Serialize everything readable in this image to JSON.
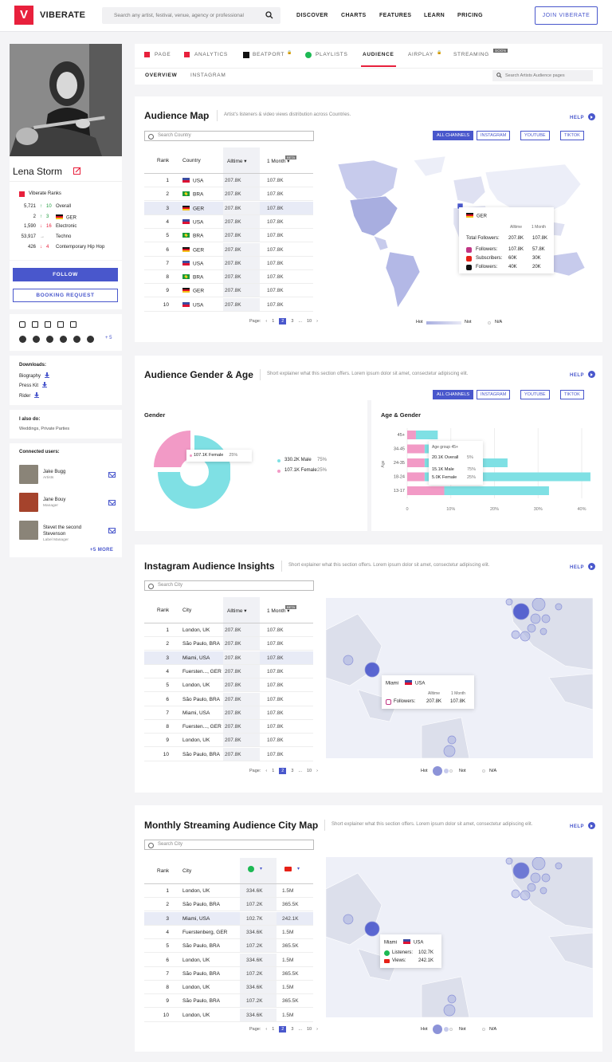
{
  "header": {
    "logo_mark": "V",
    "logo_text": "VIBERATE",
    "search_placeholder": "Search any artist, festival, venue, agency or professional",
    "nav": [
      "DISCOVER",
      "CHARTS",
      "FEATURES",
      "LEARN",
      "PRICING"
    ],
    "join": "JOIN VIBERATE"
  },
  "artist": {
    "name": "Lena Storm",
    "ranks_title": "Viberate Ranks",
    "ranks": [
      {
        "value": "5,721",
        "change": "10",
        "dir": "up",
        "label": "Overall"
      },
      {
        "value": "2",
        "change": "3",
        "dir": "up",
        "label": "GER",
        "flag": "ger"
      },
      {
        "value": "1,590",
        "change": "16",
        "dir": "down",
        "label": "Electronic"
      },
      {
        "value": "53,917",
        "change": "",
        "dir": "flat",
        "label": "Techno"
      },
      {
        "value": "426",
        "change": "4",
        "dir": "down",
        "label": "Contemporary Hip Hop"
      }
    ],
    "follow": "FOLLOW",
    "booking": "BOOKING REQUEST",
    "more_socials": "+ 5",
    "downloads_title": "Downloads:",
    "downloads": [
      "Biography",
      "Press Kit",
      "Rider"
    ],
    "also_title": "I also do:",
    "also": "Weddings, Private Parties",
    "connected_title": "Connected users:",
    "users": [
      {
        "name": "Jake Bugg",
        "role": "Artists"
      },
      {
        "name": "Jane Bouy",
        "role": "Manager"
      },
      {
        "name": "Stevet the second Stevenson",
        "role": "Label Manager"
      }
    ],
    "more_users": "+5 MORE"
  },
  "tabs": {
    "items": [
      "PAGE",
      "ANALYTICS",
      "BEATPORT",
      "PLAYLISTS",
      "AUDIENCE",
      "AIRPLAY",
      "STREAMING"
    ],
    "soon": "SOON",
    "sub": [
      "OVERVIEW",
      "INSTAGRAM"
    ],
    "search": "Search Artists Audience pages"
  },
  "audience_map": {
    "title": "Audience Map",
    "subtitle": "Artist's listeners & video views distribution across Countries.",
    "help": "HELP",
    "search": "Search Country",
    "channels": [
      "ALL CHANNELS",
      "INSTAGRAM",
      "YOUTUBE",
      "TIKTOK"
    ],
    "cols": [
      "Rank",
      "Country",
      "Alltime",
      "1 Month",
      "BETA"
    ],
    "rows": [
      [
        "1",
        "USA",
        "usa",
        "207.8K",
        "107.8K"
      ],
      [
        "2",
        "BRA",
        "bra",
        "207.8K",
        "107.8K"
      ],
      [
        "3",
        "GER",
        "ger",
        "207.8K",
        "107.8K"
      ],
      [
        "4",
        "USA",
        "usa",
        "207.8K",
        "107.8K"
      ],
      [
        "5",
        "BRA",
        "bra",
        "207.8K",
        "107.8K"
      ],
      [
        "6",
        "GER",
        "ger",
        "207.8K",
        "107.8K"
      ],
      [
        "7",
        "USA",
        "usa",
        "207.8K",
        "107.8K"
      ],
      [
        "8",
        "BRA",
        "bra",
        "207.8K",
        "107.8K"
      ],
      [
        "9",
        "GER",
        "ger",
        "207.8K",
        "107.8K"
      ],
      [
        "10",
        "USA",
        "usa",
        "207.8K",
        "107.8K"
      ]
    ],
    "tooltip": {
      "country": "GER",
      "col1": "Alltime",
      "col2": "1 Month",
      "total_label": "Total Followers:",
      "total_a": "207.8K",
      "total_b": "107.8K",
      "lines": [
        [
          "Followers:",
          "107.8K",
          "57.8K"
        ],
        [
          "Subscribers:",
          "60K",
          "30K"
        ],
        [
          "Followers:",
          "40K",
          "20K"
        ]
      ]
    },
    "legend": {
      "hot": "Hot",
      "not": "Not",
      "na": "N/A"
    }
  },
  "pagination": {
    "label": "Page:",
    "pages": [
      "1",
      "2",
      "3",
      "...",
      "10"
    ]
  },
  "gender_age": {
    "title": "Audience Gender & Age",
    "subtitle": "Short explainer what this section offers. Lorem ipsum dolor sit amet, consectetur adipiscing elit.",
    "help": "HELP",
    "gender_title": "Gender",
    "age_title": "Age & Gender",
    "female_tip": "107.1K Female",
    "female_pct": "25%",
    "legend": [
      {
        "label": "330.2K Male",
        "pct": "75%",
        "color": "#7fe0e4"
      },
      {
        "label": "107.1K Female",
        "pct": "25%",
        "color": "#f29ac6"
      }
    ],
    "age_groups": [
      "45+",
      "34-45",
      "24-35",
      "18-24",
      "13-17"
    ],
    "age_axis": "Age",
    "ticks": [
      "0",
      "10%",
      "20%",
      "30%",
      "40%"
    ],
    "age_tip": {
      "title": "Age group 45+",
      "overall": "20.1K Overall",
      "overall_pct": "5%",
      "male": "15.1K Male",
      "male_pct": "75%",
      "female": "5.0K Female",
      "female_pct": "25%"
    }
  },
  "chart_data": {
    "type": "bar",
    "orientation": "horizontal",
    "stacked": true,
    "categories": [
      "45+",
      "34-45",
      "24-35",
      "18-24",
      "13-17"
    ],
    "series": [],
    "xlim": [
      0,
      40
    ]
  },
  "chart_data_female_pct": [
    2,
    4,
    4,
    4,
    8.5
  ],
  "chart_data_male_pct": [
    5,
    5,
    19,
    38,
    24
  ],
  "instagram": {
    "title": "Instagram Audience Insights",
    "subtitle": "Short explainer what this section offers. Lorem ipsum dolor sit amet, consectetur adipiscing elit.",
    "help": "HELP",
    "search": "Search City",
    "cols": [
      "Rank",
      "City",
      "Alltime",
      "1 Month",
      "BETA"
    ],
    "rows": [
      [
        "1",
        "London, UK",
        "207.8K",
        "107.8K"
      ],
      [
        "2",
        "São Paulo, BRA",
        "207.8K",
        "107.8K"
      ],
      [
        "3",
        "Miami, USA",
        "207.8K",
        "107.8K"
      ],
      [
        "4",
        "Fuersten..., GER",
        "207.8K",
        "107.8K"
      ],
      [
        "5",
        "London, UK",
        "207.8K",
        "107.8K"
      ],
      [
        "6",
        "São Paulo, BRA",
        "207.8K",
        "107.8K"
      ],
      [
        "7",
        "Miami, USA",
        "207.8K",
        "107.8K"
      ],
      [
        "8",
        "Fuersten..., GER",
        "207.8K",
        "107.8K"
      ],
      [
        "9",
        "London, UK",
        "207.8K",
        "107.8K"
      ],
      [
        "10",
        "São Paulo, BRA",
        "207.8K",
        "107.8K"
      ]
    ],
    "tooltip": {
      "city": "Miami",
      "country": "USA",
      "col1": "Alltime",
      "col2": "1 Month",
      "label": "Followers:",
      "a": "207.8K",
      "b": "107.8K"
    }
  },
  "streaming": {
    "title": "Monthly Streaming Audience City Map",
    "subtitle": "Short explainer what this section offers. Lorem ipsum dolor sit amet, consectetur adipiscing elit.",
    "help": "HELP",
    "search": "Search City",
    "cols": [
      "Rank",
      "City"
    ],
    "rows": [
      [
        "1",
        "London, UK",
        "334.6K",
        "1.5M"
      ],
      [
        "2",
        "São Paulo, BRA",
        "107.2K",
        "365.5K"
      ],
      [
        "3",
        "Miami, USA",
        "102.7K",
        "242.1K"
      ],
      [
        "4",
        "Fuerstenberg, GER",
        "334.6K",
        "1.5M"
      ],
      [
        "5",
        "São Paulo, BRA",
        "107.2K",
        "365.5K"
      ],
      [
        "6",
        "London, UK",
        "334.6K",
        "1.5M"
      ],
      [
        "7",
        "São Paulo, BRA",
        "107.2K",
        "365.5K"
      ],
      [
        "8",
        "London, UK",
        "334.6K",
        "1.5M"
      ],
      [
        "9",
        "São Paulo, BRA",
        "107.2K",
        "365.5K"
      ],
      [
        "10",
        "London, UK",
        "334.6K",
        "1.5M"
      ]
    ],
    "tooltip": {
      "city": "Miami",
      "country": "USA",
      "l1": "Listeners:",
      "v1": "102.7K",
      "l2": "Views:",
      "v2": "242.1K"
    }
  },
  "bubble_legend": {
    "hot": "Hot",
    "not": "Not",
    "na": "N/A"
  },
  "colors": {
    "accent": "#4957cc",
    "brand": "#e8203c",
    "map": "#c7cbec",
    "teal": "#7fe0e4",
    "pink": "#f29ac6"
  }
}
